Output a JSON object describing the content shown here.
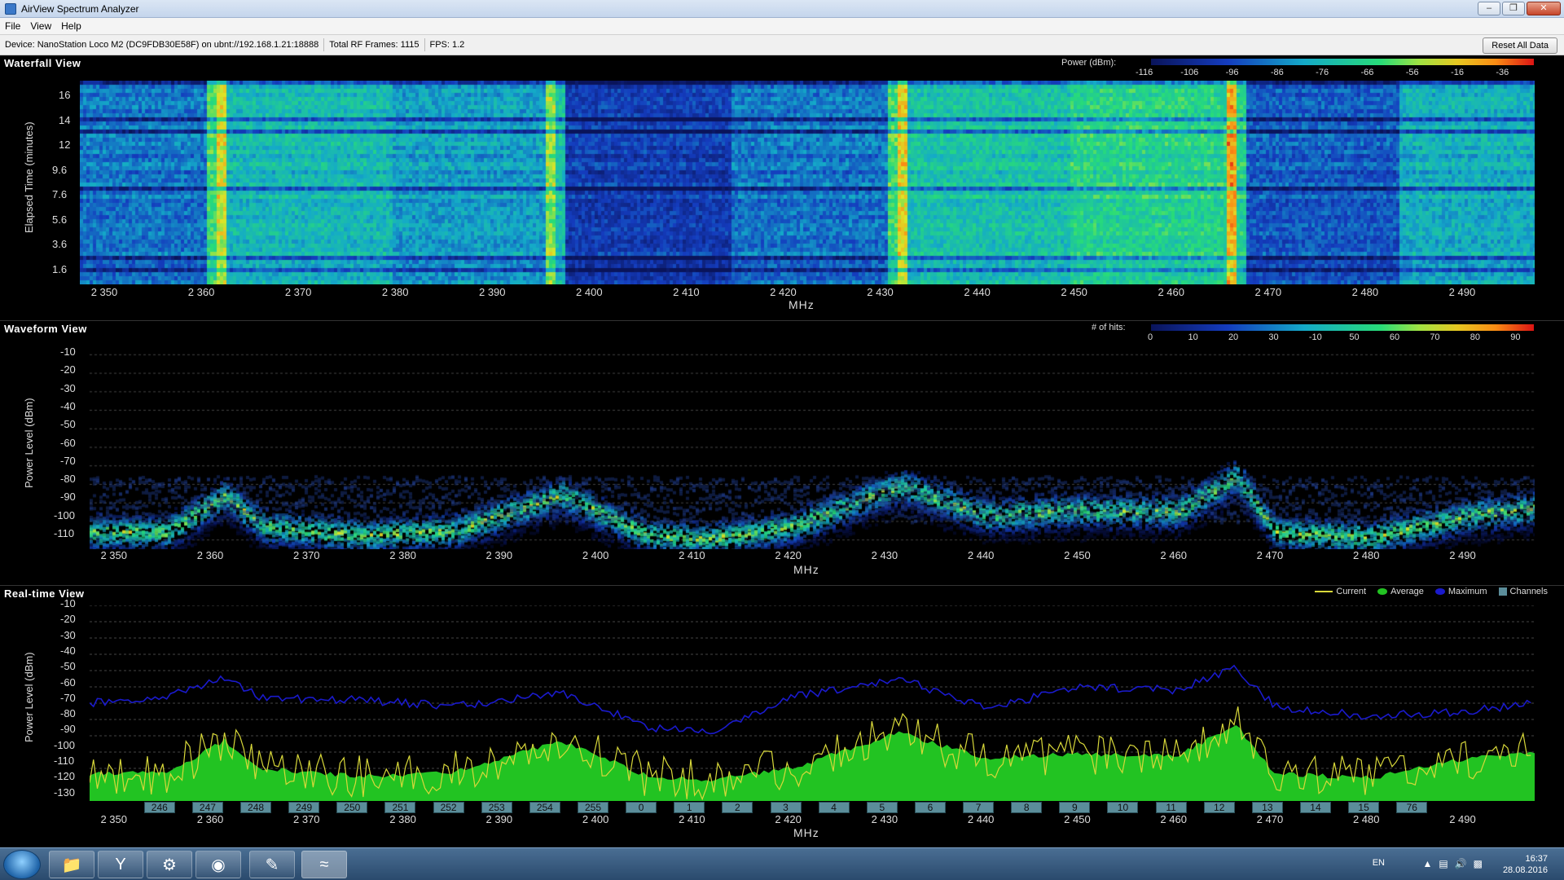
{
  "window": {
    "title": "AirView Spectrum Analyzer",
    "controls": [
      "–",
      "❐",
      "✕"
    ]
  },
  "menu": [
    "File",
    "View",
    "Help"
  ],
  "status": {
    "device": "Device: NanoStation Loco M2 (DC9FDB30E58F) on ubnt://192.168.1.21:18888",
    "frames": "Total RF Frames: 1115",
    "fps": "FPS: 1.2",
    "reset_label": "Reset All Data"
  },
  "waterfall": {
    "title": "Waterfall View",
    "legend_title": "Power (dBm):",
    "legend_ticks": [
      "-116",
      "-106",
      "-96",
      "-86",
      "-76",
      "-66",
      "-56",
      "-16",
      "-36"
    ],
    "ylabel": "Elapsed Time (minutes)",
    "yticks": [
      "16",
      "14",
      "12",
      "9.6",
      "7.6",
      "5.6",
      "3.6",
      "1.6"
    ],
    "xlabel": "MHz"
  },
  "waveform": {
    "title": "Waveform View",
    "legend_title": "# of hits:",
    "legend_ticks": [
      "0",
      "10",
      "20",
      "30",
      "-10",
      "50",
      "60",
      "70",
      "80",
      "90"
    ],
    "ylabel": "Power Level (dBm)",
    "yticks": [
      "-10",
      "-20",
      "-30",
      "-40",
      "-50",
      "-60",
      "-70",
      "-80",
      "-90",
      "-100",
      "-110"
    ],
    "xlabel": "MHz"
  },
  "realtime": {
    "title": "Real-time View",
    "legend": [
      {
        "label": "Current",
        "color": "#d8d83a"
      },
      {
        "label": "Average",
        "color": "#22c322"
      },
      {
        "label": "Maximum",
        "color": "#1a1acc"
      },
      {
        "label": "Channels",
        "color": "#5b8d9a"
      }
    ],
    "ylabel": "Power Level (dBm)",
    "yticks": [
      "-10",
      "-20",
      "-30",
      "-40",
      "-50",
      "-60",
      "-70",
      "-80",
      "-90",
      "-100",
      "-110",
      "-120",
      "-130"
    ],
    "xlabel": "MHz",
    "channels": [
      "246",
      "247",
      "248",
      "249",
      "250",
      "251",
      "252",
      "253",
      "254",
      "255",
      "0",
      "1",
      "2",
      "3",
      "4",
      "5",
      "6",
      "7",
      "8",
      "9",
      "10",
      "11",
      "12",
      "13",
      "14",
      "15",
      "76"
    ]
  },
  "xticks": [
    "2 350",
    "2 360",
    "2 370",
    "2 380",
    "2 390",
    "2 400",
    "2 410",
    "2 420",
    "2 430",
    "2 440",
    "2 450",
    "2 460",
    "2 470",
    "2 480",
    "2 490"
  ],
  "chart_data": [
    {
      "type": "heatmap",
      "title": "Waterfall View",
      "xlabel": "MHz",
      "ylabel": "Elapsed Time (minutes)",
      "xlim": [
        2347,
        2497
      ],
      "colorbar_label": "Power (dBm):"
    },
    {
      "type": "heatmap",
      "title": "Waveform View",
      "xlabel": "MHz",
      "ylabel": "Power Level (dBm)",
      "xlim": [
        2347,
        2497
      ],
      "ylim": [
        -115,
        -5
      ],
      "colorbar_label": "# of hits:",
      "peaks_mhz": [
        2361,
        2396,
        2431,
        2466
      ]
    },
    {
      "type": "line",
      "title": "Real-time View",
      "xlabel": "MHz",
      "ylabel": "Power Level (dBm)",
      "xlim": [
        2347,
        2497
      ],
      "ylim": [
        -130,
        -10
      ],
      "grid": true,
      "legend_position": "top-right",
      "series": [
        {
          "name": "Maximum",
          "x": [
            2347,
            2355,
            2361,
            2365,
            2375,
            2385,
            2396,
            2405,
            2411,
            2420,
            2431,
            2440,
            2450,
            2460,
            2466,
            2470,
            2480,
            2490,
            2497
          ],
          "values": [
            -70,
            -65,
            -55,
            -67,
            -68,
            -72,
            -63,
            -85,
            -88,
            -66,
            -55,
            -73,
            -60,
            -62,
            -48,
            -72,
            -78,
            -75,
            -70
          ]
        },
        {
          "name": "Average",
          "x": [
            2347,
            2355,
            2361,
            2365,
            2375,
            2385,
            2396,
            2405,
            2411,
            2420,
            2431,
            2440,
            2450,
            2460,
            2466,
            2470,
            2480,
            2490,
            2497
          ],
          "values": [
            -113,
            -113,
            -93,
            -110,
            -115,
            -112,
            -93,
            -115,
            -117,
            -110,
            -88,
            -104,
            -101,
            -102,
            -83,
            -113,
            -116,
            -104,
            -100
          ]
        }
      ]
    }
  ]
}
